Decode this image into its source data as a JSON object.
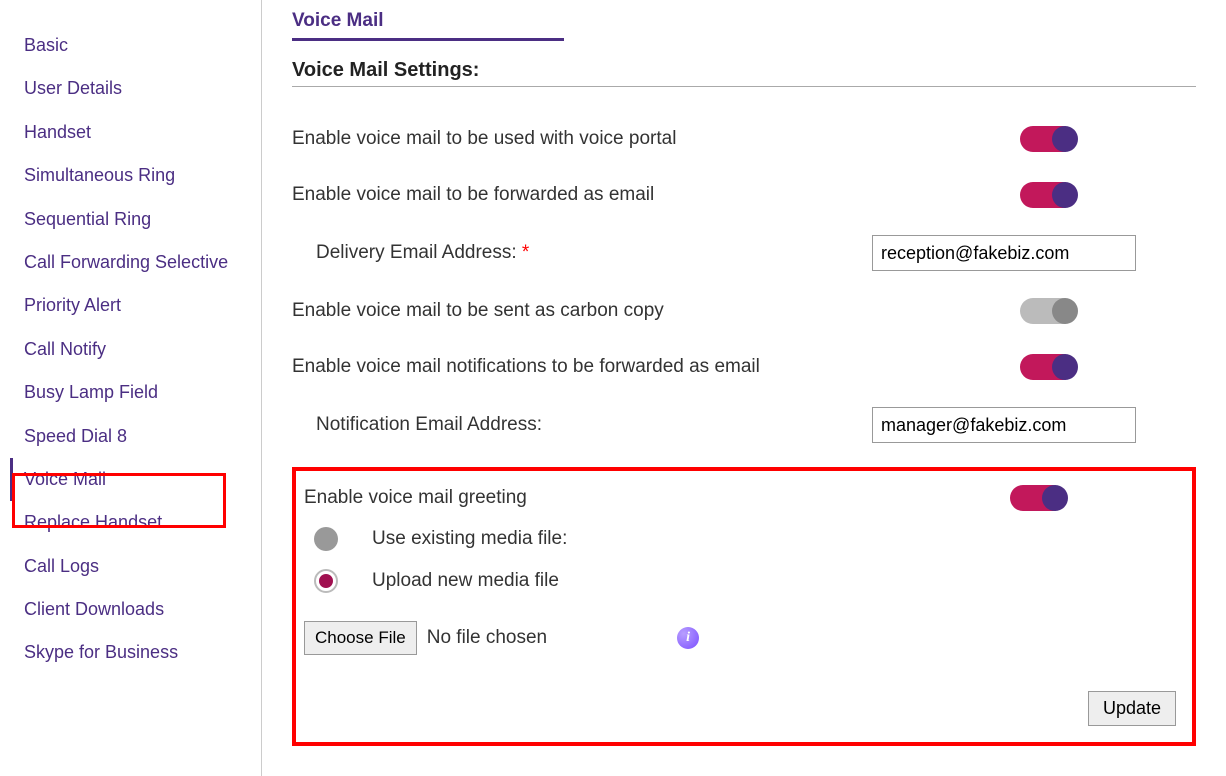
{
  "sidebar": {
    "items": [
      {
        "label": "Basic"
      },
      {
        "label": "User Details"
      },
      {
        "label": "Handset"
      },
      {
        "label": "Simultaneous Ring"
      },
      {
        "label": "Sequential Ring"
      },
      {
        "label": "Call Forwarding Selective"
      },
      {
        "label": "Priority Alert"
      },
      {
        "label": "Call Notify"
      },
      {
        "label": "Busy Lamp Field"
      },
      {
        "label": "Speed Dial 8"
      },
      {
        "label": "Voice Mail",
        "active": true
      },
      {
        "label": "Replace Handset"
      },
      {
        "label": "Call Logs"
      },
      {
        "label": "Client Downloads"
      },
      {
        "label": "Skype for Business"
      }
    ]
  },
  "page": {
    "title": "Voice Mail",
    "section_header": "Voice Mail Settings:"
  },
  "settings": {
    "voice_portal": {
      "label": "Enable voice mail to be used with voice portal",
      "on": true
    },
    "forward_email": {
      "label": "Enable voice mail to be forwarded as email",
      "on": true
    },
    "delivery_label": "Delivery Email Address:",
    "delivery_required_mark": " *",
    "delivery_value": "reception@fakebiz.com",
    "carbon_copy": {
      "label": "Enable voice mail to be sent as carbon copy",
      "on": false
    },
    "notify_email": {
      "label": "Enable voice mail notifications to be forwarded as email",
      "on": true
    },
    "notify_label": "Notification Email Address:",
    "notify_value": "manager@fakebiz.com"
  },
  "greeting": {
    "label": "Enable voice mail greeting",
    "on": true,
    "radio_existing": "Use existing media file:",
    "radio_upload": "Upload new media file",
    "selected": "upload",
    "choose_file_btn": "Choose File",
    "file_status": "No file chosen",
    "info_glyph": "i",
    "update_btn": "Update"
  }
}
